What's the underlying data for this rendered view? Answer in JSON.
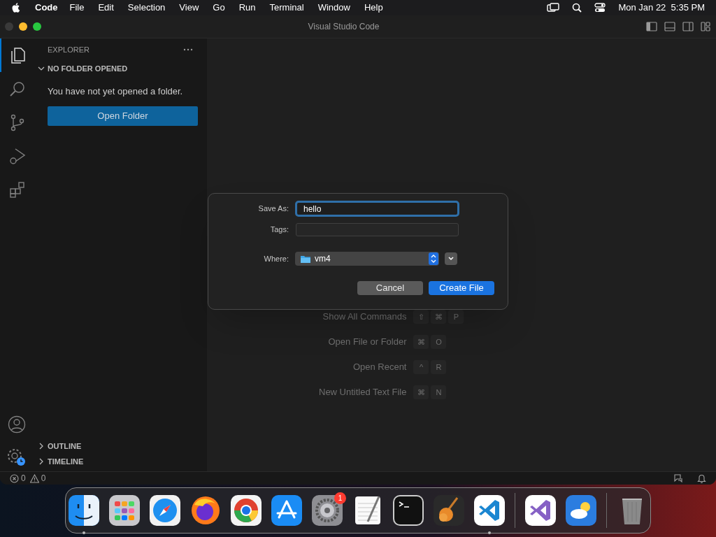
{
  "menu_bar": {
    "app_name": "Code",
    "items": [
      "File",
      "Edit",
      "Selection",
      "View",
      "Go",
      "Run",
      "Terminal",
      "Window",
      "Help"
    ],
    "clock": "Mon Jan 22  5:35 PM"
  },
  "window": {
    "title": "Visual Studio Code"
  },
  "activity_bar": [
    {
      "kind": "files",
      "selected": true
    },
    {
      "kind": "search",
      "selected": false
    },
    {
      "kind": "source-control",
      "selected": false
    },
    {
      "kind": "run",
      "selected": false
    },
    {
      "kind": "extensions",
      "selected": false
    }
  ],
  "sidebar": {
    "title": "EXPLORER",
    "sections": [
      {
        "title": "NO FOLDER OPENED",
        "expanded": true,
        "message": "You have not yet opened a folder.",
        "button": "Open Folder"
      },
      {
        "title": "OUTLINE",
        "expanded": false
      },
      {
        "title": "TIMELINE",
        "expanded": false
      }
    ]
  },
  "shortcuts": [
    {
      "label": "Show All Commands",
      "keys": [
        "⇧",
        "⌘",
        "P"
      ]
    },
    {
      "label": "Open File or Folder",
      "keys": [
        "⌘",
        "O"
      ]
    },
    {
      "label": "Open Recent",
      "keys": [
        "^",
        "R"
      ]
    },
    {
      "label": "New Untitled Text File",
      "keys": [
        "⌘",
        "N"
      ]
    }
  ],
  "save_dialog": {
    "save_as_label": "Save As:",
    "save_as_value": "hello",
    "tags_label": "Tags:",
    "where_label": "Where:",
    "where_value": "vm4",
    "buttons": [
      "Cancel",
      "Create File"
    ]
  },
  "status_bar": {
    "errors": "0",
    "warnings": "0"
  },
  "dock": [
    {
      "kind": "finder",
      "running": true
    },
    {
      "kind": "launchpad",
      "running": false
    },
    {
      "kind": "safari",
      "running": false
    },
    {
      "kind": "firefox",
      "running": false
    },
    {
      "kind": "chrome",
      "running": false
    },
    {
      "kind": "appstore",
      "running": false
    },
    {
      "kind": "settings",
      "running": false,
      "badge": "1"
    },
    {
      "kind": "textedit",
      "running": false
    },
    {
      "kind": "terminal",
      "running": false
    },
    {
      "kind": "garageband",
      "running": false
    },
    {
      "kind": "vscode",
      "running": true
    },
    {
      "kind": "divider"
    },
    {
      "kind": "visualstudio",
      "running": false
    },
    {
      "kind": "weather",
      "running": false
    },
    {
      "kind": "divider"
    },
    {
      "kind": "trash",
      "running": false
    }
  ]
}
